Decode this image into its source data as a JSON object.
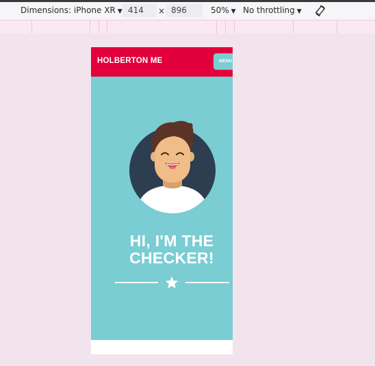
{
  "devtools": {
    "dimensions_label": "Dimensions: iPhone XR",
    "width_value": "414",
    "times_sign": "×",
    "height_value": "896",
    "zoom": "50%",
    "throttling": "No throttling",
    "icons": {
      "caret": "caret-down-icon",
      "rotate": "rotate-icon"
    }
  },
  "site": {
    "brand": "HOLBERTON ME",
    "menu_label": "MENU",
    "hero_title_line1": "HI, I'M THE",
    "hero_title_line2": "CHECKER!",
    "colors": {
      "header": "#e1003c",
      "hero": "#7acdd2",
      "avatar_circle": "#2c3e50"
    },
    "icons": {
      "avatar": "avatar-illustration",
      "star": "star-icon"
    }
  }
}
